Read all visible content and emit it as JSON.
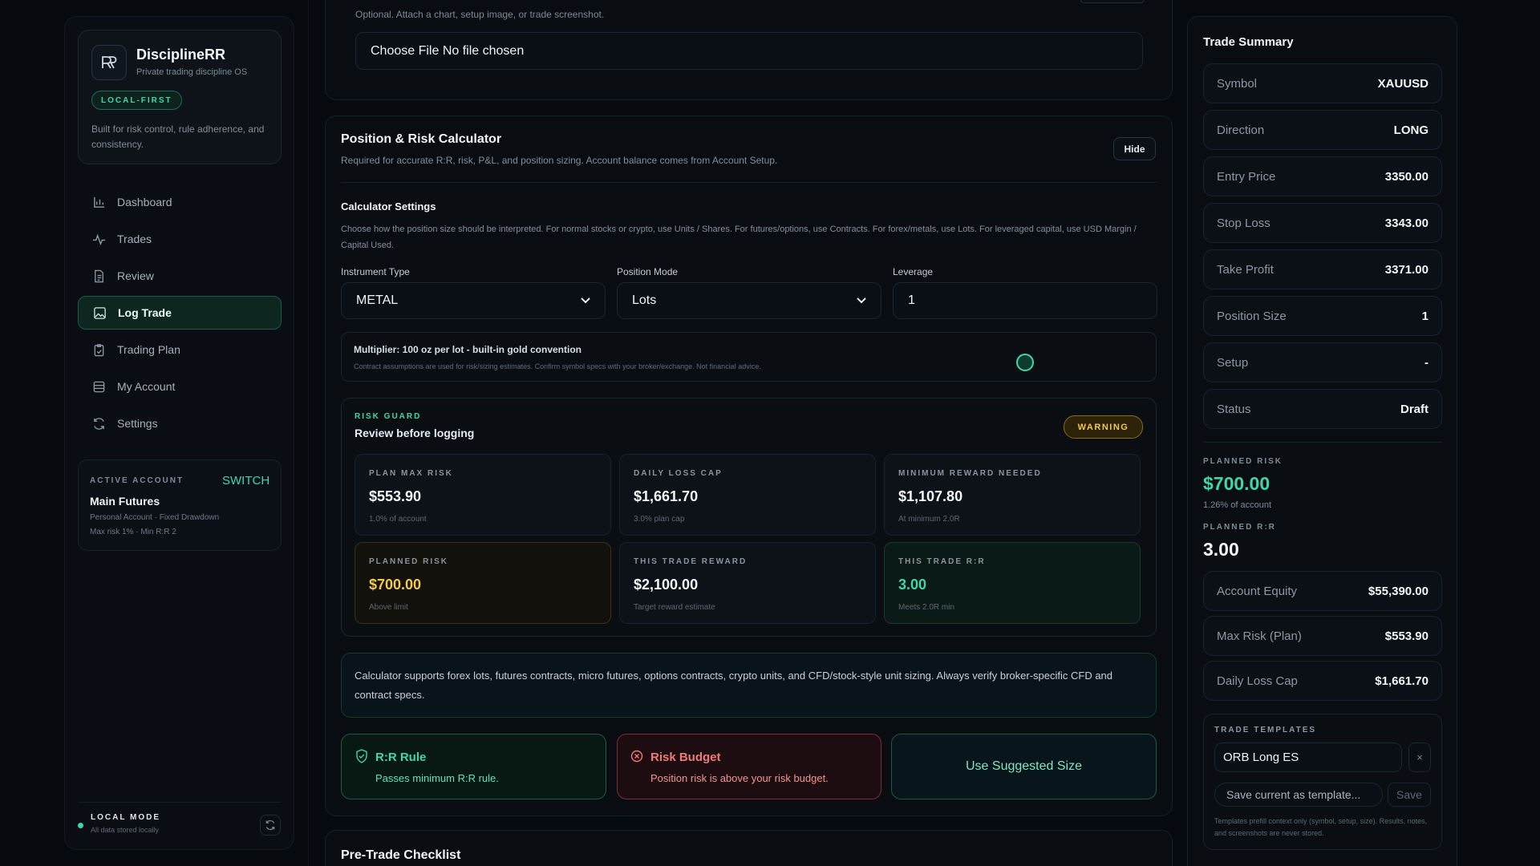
{
  "sidebar": {
    "brand_name": "DisciplineRR",
    "brand_sub": "Private trading discipline OS",
    "badge": "LOCAL-FIRST",
    "description": "Built for risk control, rule adherence, and consistency.",
    "nav": [
      {
        "label": "Dashboard",
        "icon": "bar-chart-icon"
      },
      {
        "label": "Trades",
        "icon": "pulse-icon"
      },
      {
        "label": "Review",
        "icon": "document-icon"
      },
      {
        "label": "Log Trade",
        "icon": "image-icon"
      },
      {
        "label": "Trading Plan",
        "icon": "clipboard-icon"
      },
      {
        "label": "My Account",
        "icon": "database-icon"
      },
      {
        "label": "Settings",
        "icon": "refresh-icon"
      }
    ],
    "account": {
      "heading": "ACTIVE ACCOUNT",
      "switch_label": "SWITCH",
      "name": "Main Futures",
      "line1": "Personal Account · Fixed Drawdown",
      "line2": "Max risk 1% · Min R:R 2"
    },
    "local_mode": {
      "title": "LOCAL MODE",
      "sub": "All data stored locally"
    }
  },
  "attachment": {
    "hint": "Optional. Attach a chart, setup image, or trade screenshot.",
    "file_value": "Choose File No file chosen"
  },
  "calculator": {
    "title": "Position & Risk Calculator",
    "subtitle": "Required for accurate R:R, risk, P&L, and position sizing. Account balance comes from Account Setup.",
    "hide_label": "Hide",
    "settings_title": "Calculator Settings",
    "settings_desc": "Choose how the position size should be interpreted. For normal stocks or crypto, use Units / Shares. For futures/options, use Contracts. For forex/metals, use Lots. For leveraged capital, use USD Margin / Capital Used.",
    "instrument_label": "Instrument Type",
    "instrument_value": "METAL",
    "mode_label": "Position Mode",
    "mode_value": "Lots",
    "leverage_label": "Leverage",
    "leverage_value": "1",
    "multiplier_title": "Multiplier: 100 oz per lot - built-in gold convention",
    "multiplier_note": "Contract assumptions are used for risk/sizing estimates. Confirm symbol specs with your broker/exchange. Not financial advice.",
    "risk_guard": {
      "eyebrow": "RISK GUARD",
      "title": "Review before logging",
      "badge": "WARNING",
      "cards": [
        {
          "title": "PLAN MAX RISK",
          "value": "$553.90",
          "sub": "1.0% of account"
        },
        {
          "title": "DAILY LOSS CAP",
          "value": "$1,661.70",
          "sub": "3.0% plan cap"
        },
        {
          "title": "MINIMUM REWARD NEEDED",
          "value": "$1,107.80",
          "sub": "At minimum 2.0R"
        },
        {
          "title": "PLANNED RISK",
          "value": "$700.00",
          "sub": "Above limit"
        },
        {
          "title": "THIS TRADE REWARD",
          "value": "$2,100.00",
          "sub": "Target reward estimate"
        },
        {
          "title": "THIS TRADE R:R",
          "value": "3.00",
          "sub": "Meets 2.0R min"
        }
      ]
    },
    "support_note": "Calculator supports forex lots, futures contracts, micro futures, options contracts, crypto units, and CFD/stock-style unit sizing. Always verify broker-specific CFD and contract specs.",
    "rr_rule": {
      "title": "R:R Rule",
      "sub": "Passes minimum R:R rule."
    },
    "risk_budget": {
      "title": "Risk Budget",
      "sub": "Position risk is above your risk budget."
    },
    "suggest_label": "Use Suggested Size"
  },
  "checklist_title": "Pre-Trade Checklist",
  "summary": {
    "title": "Trade Summary",
    "rows": [
      {
        "k": "Symbol",
        "v": "XAUUSD"
      },
      {
        "k": "Direction",
        "v": "LONG"
      },
      {
        "k": "Entry Price",
        "v": "3350.00"
      },
      {
        "k": "Stop Loss",
        "v": "3343.00"
      },
      {
        "k": "Take Profit",
        "v": "3371.00"
      },
      {
        "k": "Position Size",
        "v": "1"
      },
      {
        "k": "Setup",
        "v": "-"
      },
      {
        "k": "Status",
        "v": "Draft"
      }
    ],
    "planned_risk_label": "PLANNED RISK",
    "planned_risk_value": "$700.00",
    "planned_risk_sub": "1.26% of account",
    "planned_rr_label": "PLANNED R:R",
    "planned_rr_value": "3.00",
    "rows2": [
      {
        "k": "Account Equity",
        "v": "$55,390.00"
      },
      {
        "k": "Max Risk (Plan)",
        "v": "$553.90"
      },
      {
        "k": "Daily Loss Cap",
        "v": "$1,661.70"
      }
    ],
    "templates": {
      "title": "TRADE TEMPLATES",
      "selected": "ORB Long ES",
      "save_placeholder": "Save current as template...",
      "save_label": "Save",
      "note": "Templates prefill context only (symbol, setup, size). Results, notes, and screenshots are never stored."
    }
  },
  "colors": {
    "accent": "#3fd7a8",
    "warning": "#f2c94c",
    "danger": "#f07a7a"
  }
}
